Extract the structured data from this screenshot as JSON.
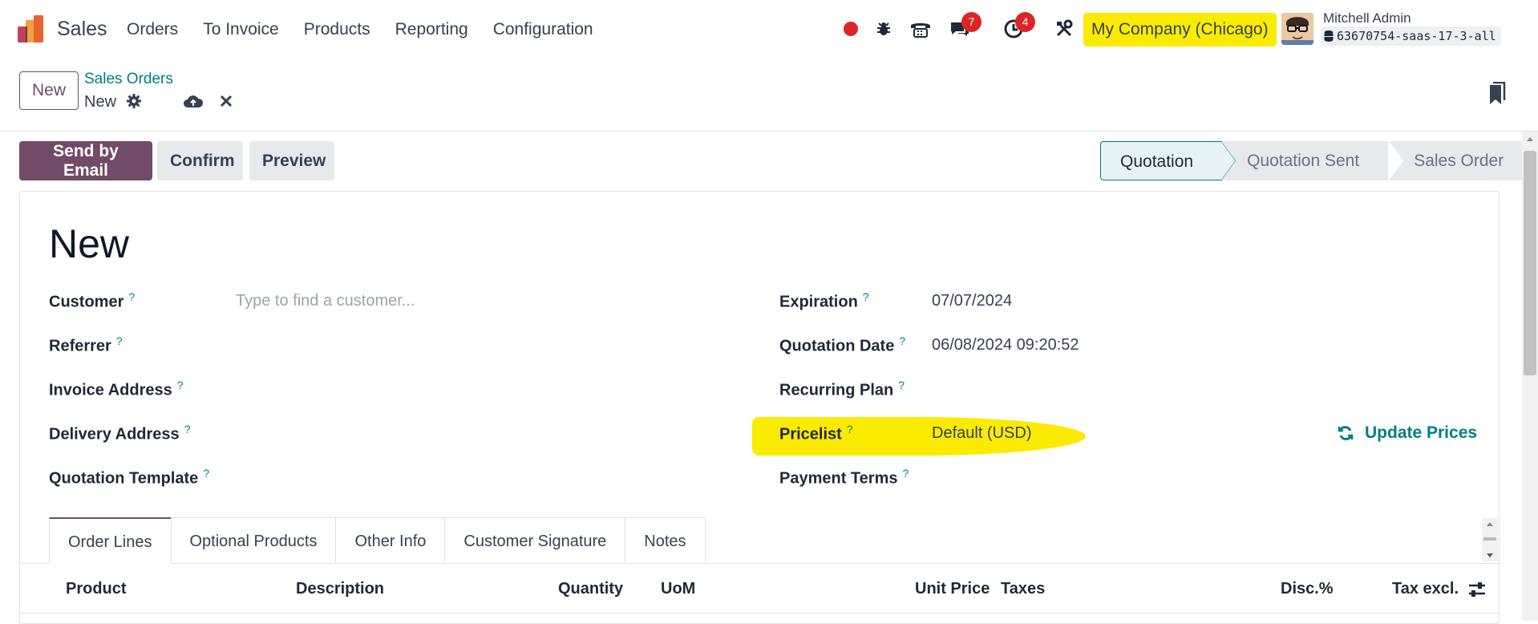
{
  "navbar": {
    "app_name": "Sales",
    "menu": [
      "Orders",
      "To Invoice",
      "Products",
      "Reporting",
      "Configuration"
    ],
    "messages_count": "7",
    "activities_count": "4",
    "company": "My Company (Chicago)",
    "user_name": "Mitchell Admin",
    "database": "63670754-saas-17-3-all"
  },
  "control": {
    "new_label": "New",
    "breadcrumb_parent": "Sales Orders",
    "breadcrumb_current": "New"
  },
  "actions": {
    "send_by_email": "Send by Email",
    "confirm": "Confirm",
    "preview": "Preview"
  },
  "statusbar": {
    "stages": [
      "Quotation",
      "Quotation Sent",
      "Sales Order"
    ],
    "active": "Quotation"
  },
  "form": {
    "title": "New",
    "left_fields": [
      {
        "label": "Customer",
        "value": "",
        "placeholder": "Type to find a customer..."
      },
      {
        "label": "Referrer",
        "value": ""
      },
      {
        "label": "Invoice Address",
        "value": ""
      },
      {
        "label": "Delivery Address",
        "value": ""
      },
      {
        "label": "Quotation Template",
        "value": ""
      }
    ],
    "right_fields": [
      {
        "label": "Expiration",
        "value": "07/07/2024"
      },
      {
        "label": "Quotation Date",
        "value": "06/08/2024 09:20:52"
      },
      {
        "label": "Recurring Plan",
        "value": ""
      },
      {
        "label": "Pricelist",
        "value": "Default (USD)"
      },
      {
        "label": "Payment Terms",
        "value": ""
      }
    ],
    "help_mark": "?",
    "update_prices": "Update Prices"
  },
  "tabs": [
    "Order Lines",
    "Optional Products",
    "Other Info",
    "Customer Signature",
    "Notes"
  ],
  "table": {
    "columns": [
      "Product",
      "Description",
      "Quantity",
      "UoM",
      "Unit Price",
      "Taxes",
      "Disc.%",
      "Tax excl."
    ]
  },
  "colors": {
    "brand": "#714b67",
    "link": "#017e84",
    "highlight": "#fbeb00",
    "badge": "#dc2626"
  }
}
